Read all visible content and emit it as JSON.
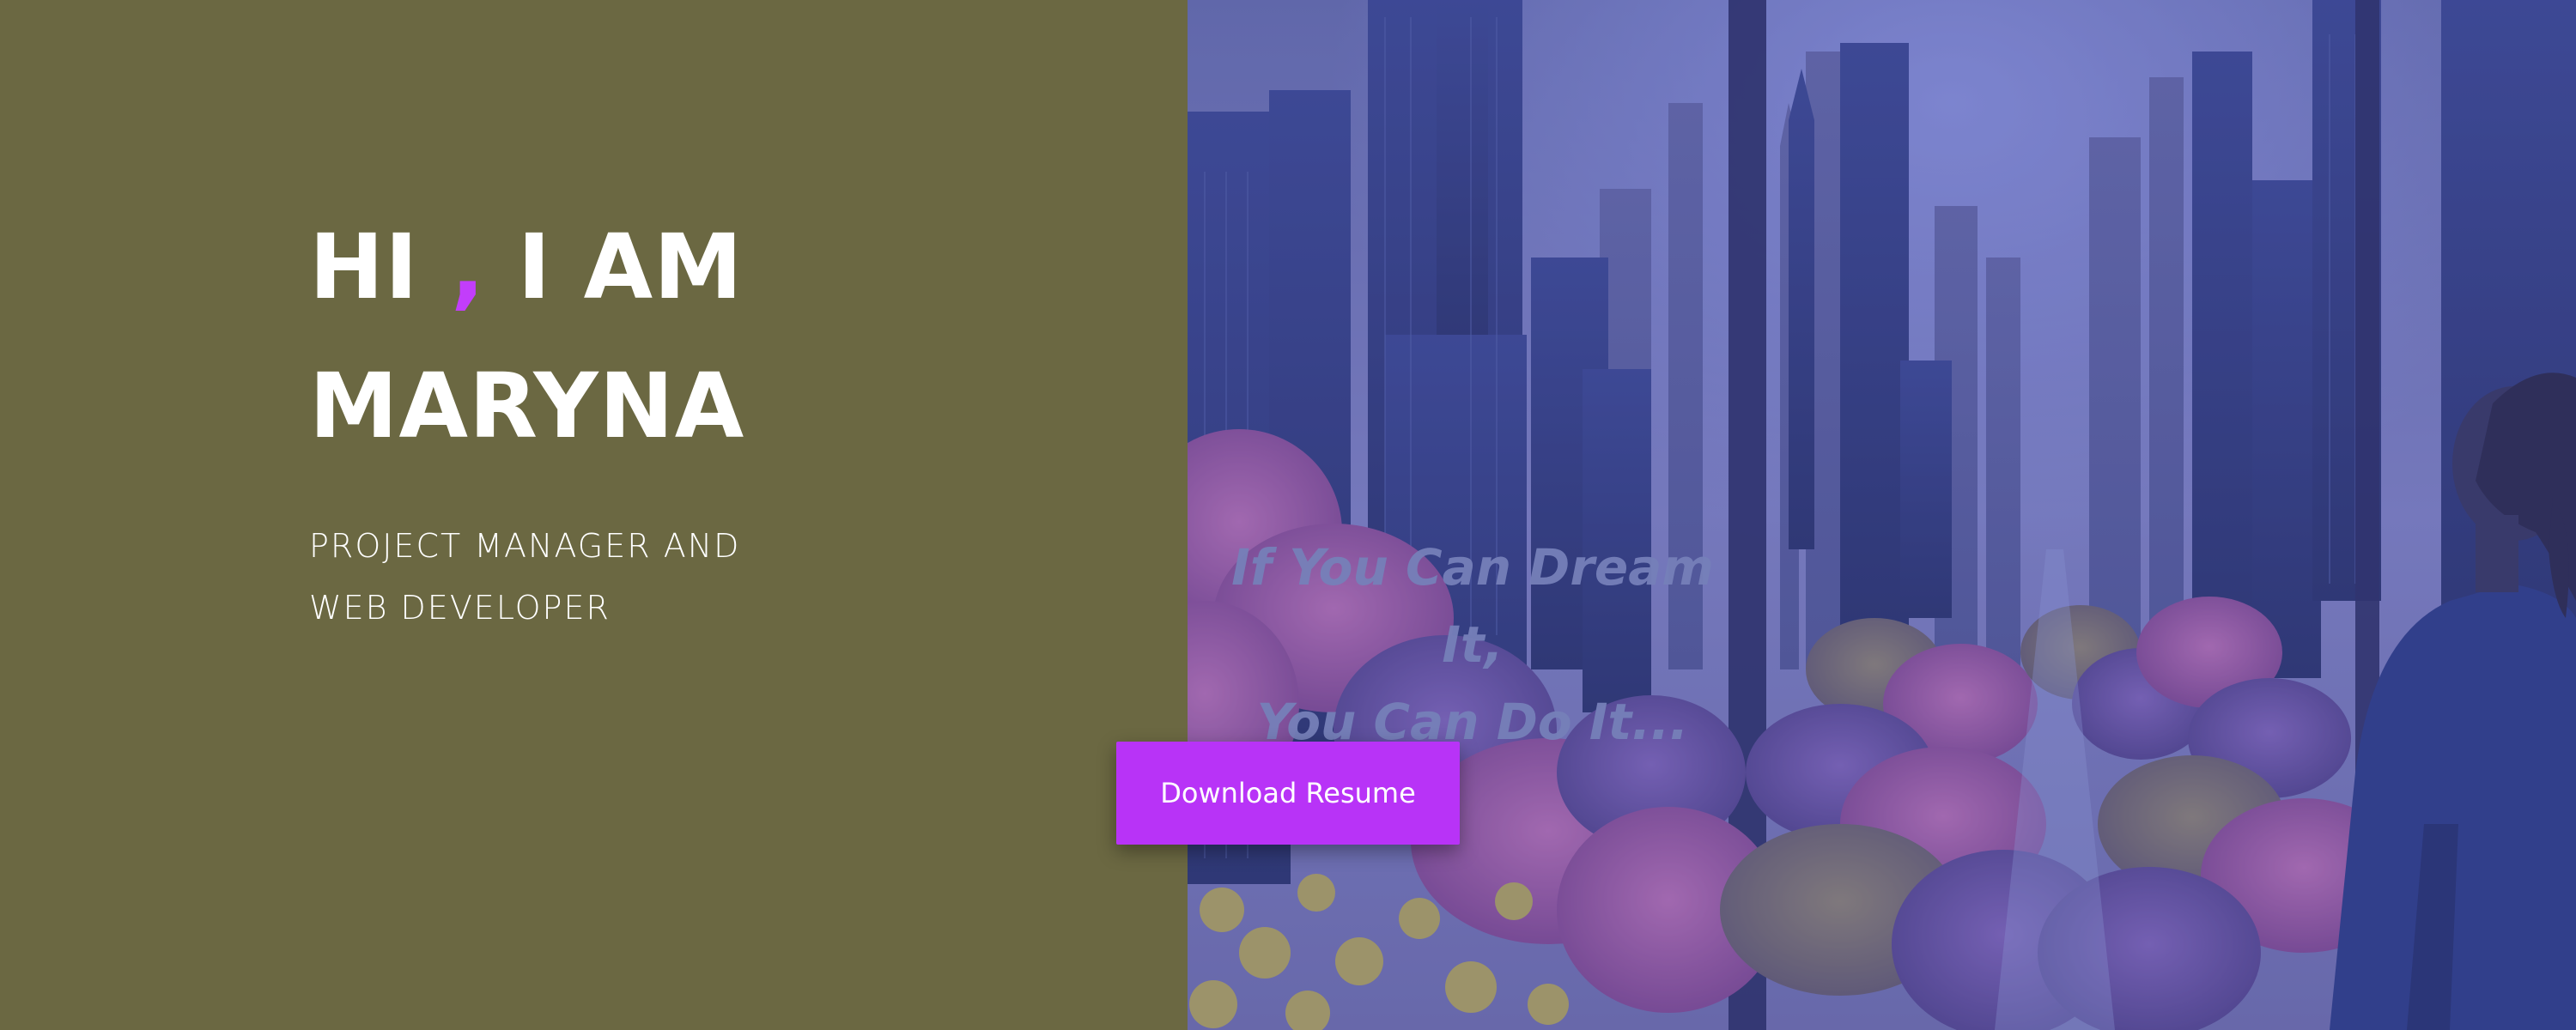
{
  "hero": {
    "greeting_pre": "HI ",
    "greeting_comma": ",",
    "greeting_post": " I AM",
    "name": "MARYNA",
    "subtitle_line1": "PROJECT MANAGER AND",
    "subtitle_line2": "WEB DEVELOPER",
    "download_label": "Download Resume"
  },
  "image": {
    "quote_line1": "If You Can Dream It,",
    "quote_line2": "You Can Do It..."
  },
  "colors": {
    "left_panel": "#6b6842",
    "accent": "#c23dfb",
    "button": "#b833f7",
    "image_overlay": "#3a3f8a"
  },
  "icons": []
}
